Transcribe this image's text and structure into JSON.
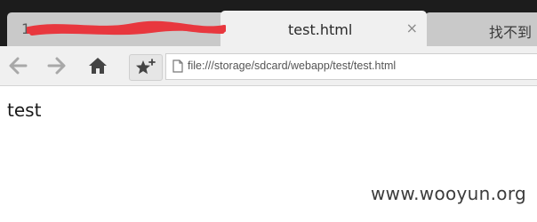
{
  "tabs": [
    {
      "title": "1",
      "state": "inactive",
      "obscured": true
    },
    {
      "title": "test.html",
      "state": "active",
      "close": "×"
    },
    {
      "title": "找不到",
      "state": "inactive"
    }
  ],
  "toolbar": {
    "back_icon": "back-arrow-icon",
    "forward_icon": "forward-arrow-icon",
    "home_icon": "home-icon",
    "bookmark_icon": "bookmark-add-star-icon",
    "page_icon": "file-page-icon",
    "url": "file:///storage/sdcard/webapp/test/test.html"
  },
  "content": {
    "body_text": "test"
  },
  "watermark": "www.wooyun.org",
  "colors": {
    "tabstrip": "#1c1c1c",
    "active_tab": "#f0f0f0",
    "inactive_tab": "#c9c9c9",
    "redaction": "#e8373e"
  }
}
